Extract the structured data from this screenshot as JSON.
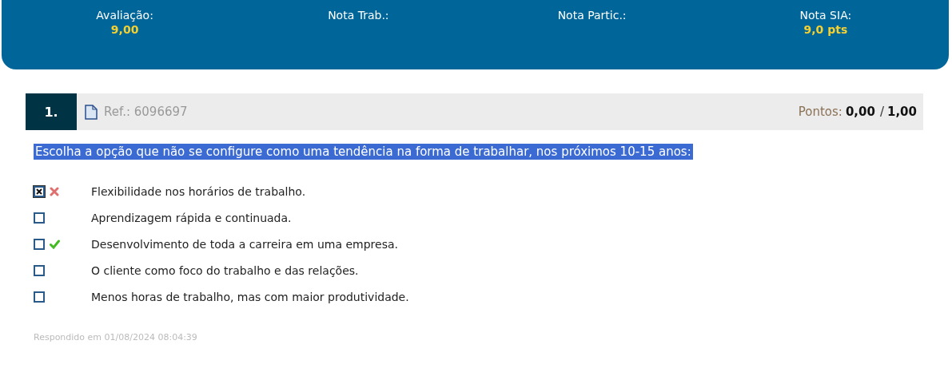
{
  "summary": [
    {
      "label": "Avaliação:",
      "value": "9,00"
    },
    {
      "label": "Nota Trab.:"
    },
    {
      "label": "Nota Partic.:"
    },
    {
      "label": "Nota SIA:",
      "value": "9,0 pts"
    }
  ],
  "question": {
    "number": "1.",
    "ref": "Ref.: 6096697",
    "points_label": "Pontos:",
    "points_score": "0,00",
    "points_separator": "/",
    "points_total": "1,00",
    "text": "Escolha a opção que não se configure como uma tendência na forma de trabalhar, nos próximos 10-15 anos:",
    "options": [
      {
        "text": "Flexibilidade nos horários de trabalho.",
        "checked": true,
        "kind": "wrong"
      },
      {
        "text": "Aprendizagem rápida e continuada.",
        "checked": false,
        "kind": "plain"
      },
      {
        "text": "Desenvolvimento de toda a carreira em uma empresa.",
        "checked": false,
        "kind": "correct"
      },
      {
        "text": "O cliente como foco do trabalho e das relações.",
        "checked": false,
        "kind": "plain"
      },
      {
        "text": "Menos horas de trabalho, mas com maior produtividade.",
        "checked": false,
        "kind": "plain"
      }
    ],
    "answered": "Respondido em 01/08/2024 08:04:39"
  }
}
